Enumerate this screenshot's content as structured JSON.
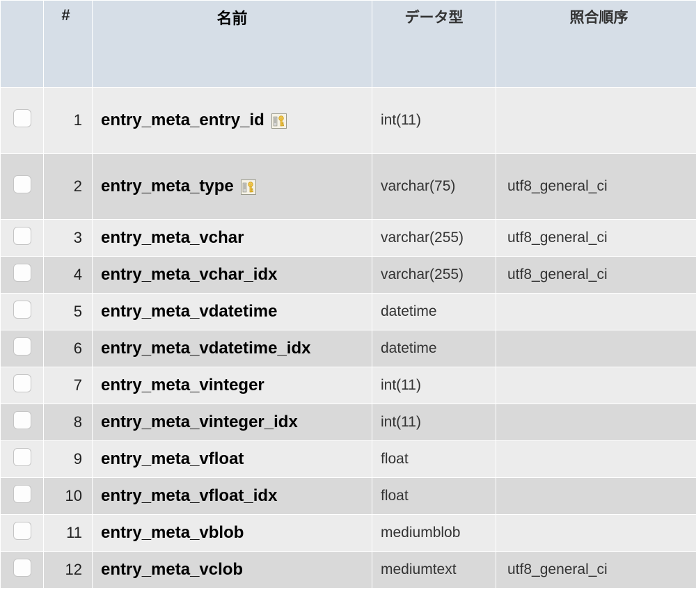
{
  "headers": {
    "checkbox": "",
    "index": "#",
    "name": "名前",
    "type": "データ型",
    "collation": "照合順序"
  },
  "rows": [
    {
      "num": "1",
      "name": "entry_meta_entry_id",
      "type": "int(11)",
      "collation": "",
      "key": true,
      "tall": true
    },
    {
      "num": "2",
      "name": "entry_meta_type",
      "type": "varchar(75)",
      "collation": "utf8_general_ci",
      "key": true,
      "tall": true
    },
    {
      "num": "3",
      "name": "entry_meta_vchar",
      "type": "varchar(255)",
      "collation": "utf8_general_ci",
      "key": false,
      "tall": false
    },
    {
      "num": "4",
      "name": "entry_meta_vchar_idx",
      "type": "varchar(255)",
      "collation": "utf8_general_ci",
      "key": false,
      "tall": false
    },
    {
      "num": "5",
      "name": "entry_meta_vdatetime",
      "type": "datetime",
      "collation": "",
      "key": false,
      "tall": false
    },
    {
      "num": "6",
      "name": "entry_meta_vdatetime_idx",
      "type": "datetime",
      "collation": "",
      "key": false,
      "tall": false
    },
    {
      "num": "7",
      "name": "entry_meta_vinteger",
      "type": "int(11)",
      "collation": "",
      "key": false,
      "tall": false
    },
    {
      "num": "8",
      "name": "entry_meta_vinteger_idx",
      "type": "int(11)",
      "collation": "",
      "key": false,
      "tall": false
    },
    {
      "num": "9",
      "name": "entry_meta_vfloat",
      "type": "float",
      "collation": "",
      "key": false,
      "tall": false
    },
    {
      "num": "10",
      "name": "entry_meta_vfloat_idx",
      "type": "float",
      "collation": "",
      "key": false,
      "tall": false
    },
    {
      "num": "11",
      "name": "entry_meta_vblob",
      "type": "mediumblob",
      "collation": "",
      "key": false,
      "tall": false
    },
    {
      "num": "12",
      "name": "entry_meta_vclob",
      "type": "mediumtext",
      "collation": "utf8_general_ci",
      "key": false,
      "tall": false
    }
  ]
}
